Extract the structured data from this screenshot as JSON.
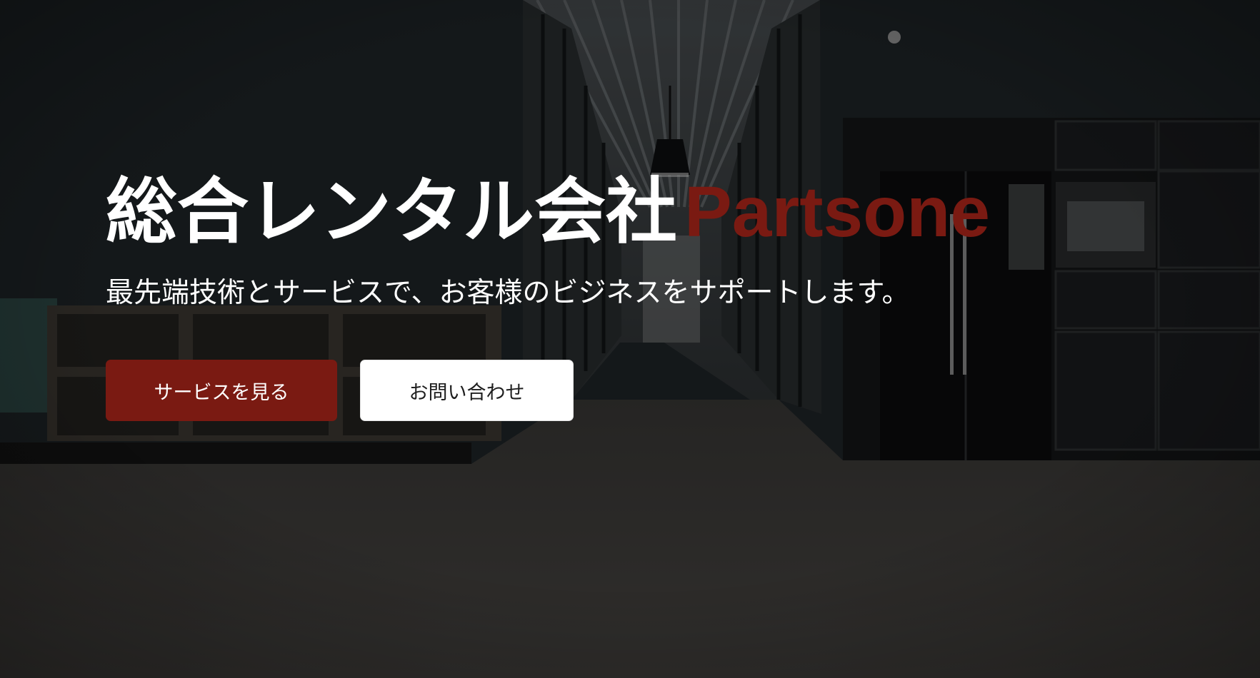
{
  "hero": {
    "title": "総合レンタル会社",
    "brand": "Partsone",
    "subtitle": "最先端技術とサービスで、お客様のビジネスをサポートします。",
    "primary_button": "サービスを見る",
    "secondary_button": "お問い合わせ"
  },
  "colors": {
    "accent": "#7a1a12",
    "text": "#ffffff",
    "button_secondary_bg": "#ffffff"
  }
}
